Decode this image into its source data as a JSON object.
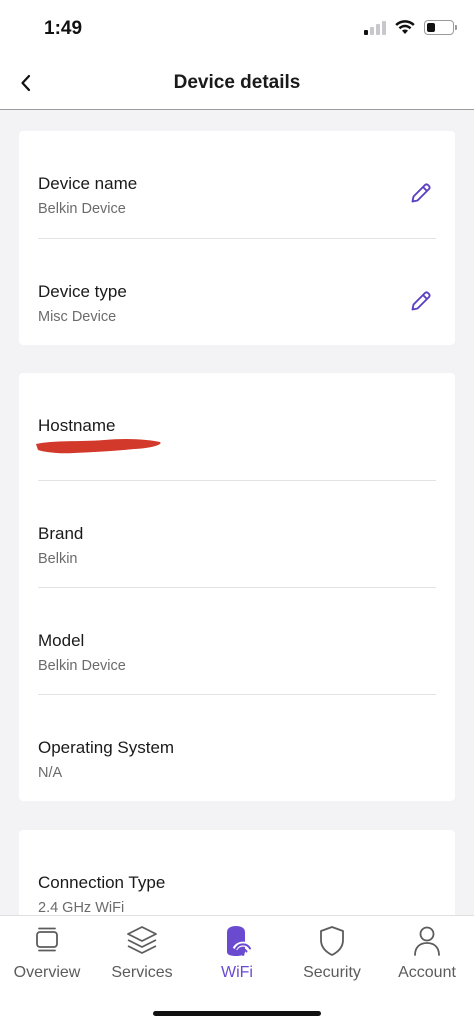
{
  "status_bar": {
    "time": "1:49"
  },
  "nav": {
    "title": "Device details"
  },
  "card_device": {
    "rows": [
      {
        "label": "Device name",
        "value": "Belkin Device"
      },
      {
        "label": "Device type",
        "value": "Misc Device"
      }
    ]
  },
  "card_info": {
    "rows": [
      {
        "label": "Hostname",
        "value": ""
      },
      {
        "label": "Brand",
        "value": "Belkin"
      },
      {
        "label": "Model",
        "value": "Belkin Device"
      },
      {
        "label": "Operating System",
        "value": "N/A"
      }
    ]
  },
  "card_connection": {
    "rows": [
      {
        "label": "Connection Type",
        "value": "2.4 GHz WiFi"
      }
    ]
  },
  "tabs": [
    {
      "label": "Overview",
      "icon": "overview-icon"
    },
    {
      "label": "Services",
      "icon": "layers-icon"
    },
    {
      "label": "WiFi",
      "icon": "wifi-device-icon",
      "active": true
    },
    {
      "label": "Security",
      "icon": "shield-icon"
    },
    {
      "label": "Account",
      "icon": "person-icon"
    }
  ],
  "colors": {
    "accent": "#6a4bd0",
    "redaction": "#d2392b",
    "background": "#f3f3f5"
  }
}
